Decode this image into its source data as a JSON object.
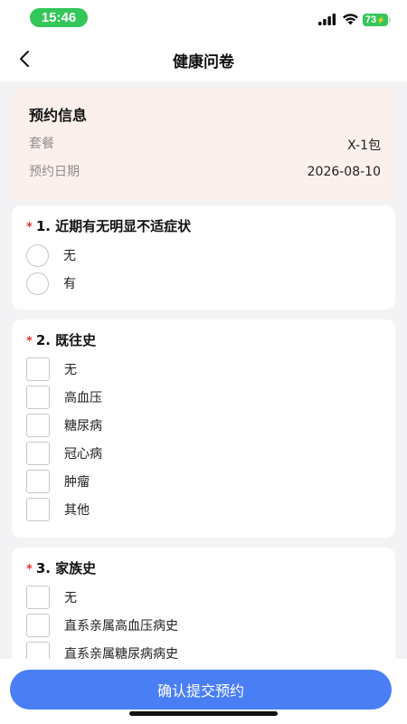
{
  "status_bar": {
    "time": "15:46",
    "battery": "73",
    "icons": [
      "signal-icon",
      "wifi-icon",
      "battery-icon"
    ]
  },
  "nav": {
    "back_icon": "chevron-left-icon",
    "title": "健康问卷"
  },
  "booking_info": {
    "title": "预约信息",
    "rows": [
      {
        "label": "套餐",
        "value": "X-1包"
      },
      {
        "label": "预约日期",
        "value": "2026-08-10"
      }
    ]
  },
  "questions": [
    {
      "required_mark": "*",
      "title": "1. 近期有无明显不适症状",
      "type": "radio",
      "options": [
        "无",
        "有"
      ]
    },
    {
      "required_mark": "*",
      "title": "2. 既往史",
      "type": "checkbox",
      "options": [
        "无",
        "高血压",
        "糖尿病",
        "冠心病",
        "肿瘤",
        "其他"
      ]
    },
    {
      "required_mark": "*",
      "title": "3. 家族史",
      "type": "checkbox",
      "options": [
        "无",
        "直系亲属高血压病史",
        "直系亲属糖尿病病史"
      ]
    }
  ],
  "footer": {
    "submit_label": "确认提交预约"
  },
  "colors": {
    "accent": "#4a7ef5",
    "required": "#e5342f",
    "status_green": "#33c759",
    "info_card_bg": "#fcf0ed"
  }
}
